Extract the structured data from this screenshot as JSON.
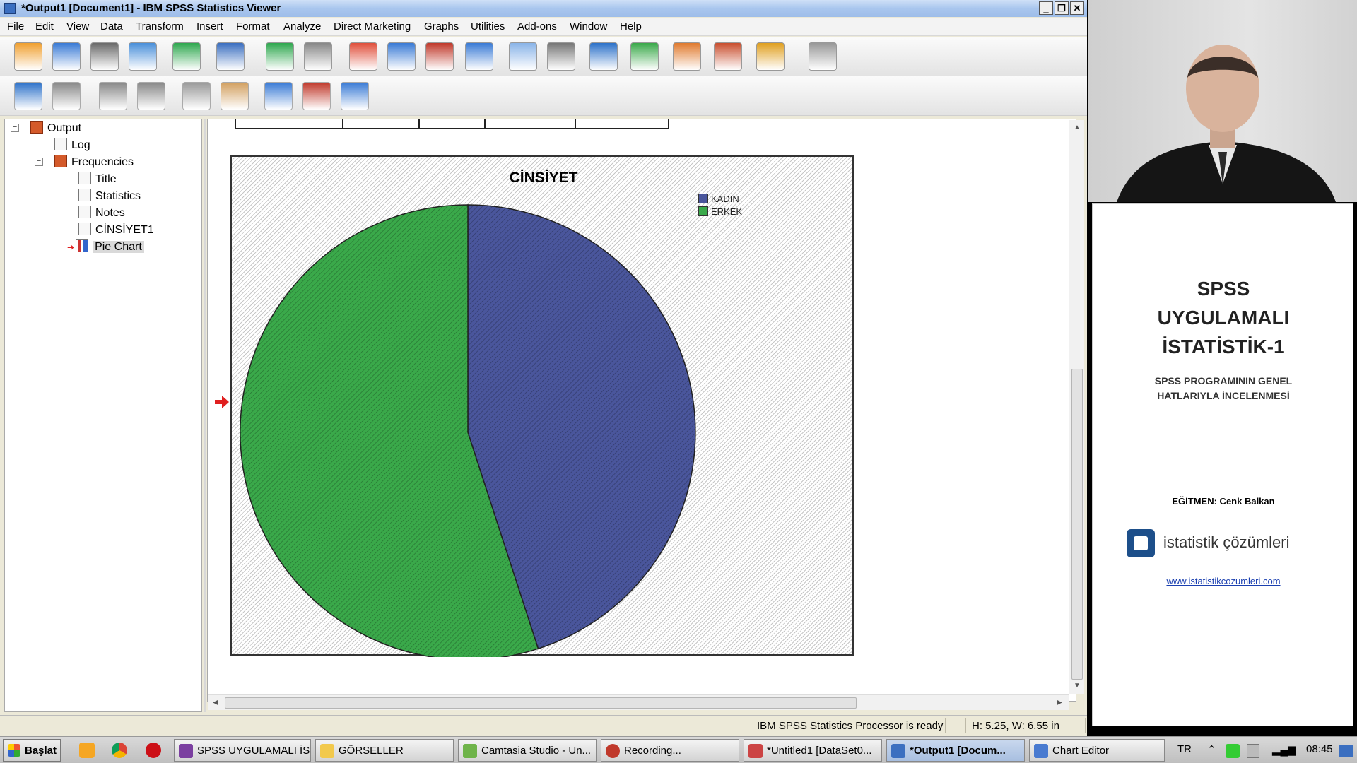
{
  "window": {
    "title": "*Output1 [Document1] - IBM SPSS Statistics Viewer",
    "controls": {
      "minimize": "_",
      "restore": "❐",
      "close": "✕"
    }
  },
  "menu": [
    "File",
    "Edit",
    "View",
    "Data",
    "Transform",
    "Insert",
    "Format",
    "Analyze",
    "Direct Marketing",
    "Graphs",
    "Utilities",
    "Add-ons",
    "Window",
    "Help"
  ],
  "toolbar1_icons": [
    "open-icon",
    "save-icon",
    "print-icon",
    "print-preview-icon",
    "export-icon",
    "recall-dialog-icon",
    "undo-icon",
    "redo-icon",
    "goto-data-icon",
    "goto-case-icon",
    "goto-variable-icon",
    "variables-icon",
    "use-sets-icon",
    "show-all-variables-icon",
    "designate-window-icon",
    "pivot-table-icon",
    "chart-builder-icon",
    "script-icon",
    "run-script-icon",
    "disabled-icon"
  ],
  "toolbar2_icons": [
    "back-icon",
    "forward-icon",
    "expand-icon",
    "collapse-icon",
    "show-icon",
    "hide-icon",
    "insert-heading-icon",
    "insert-title-icon",
    "insert-text-icon"
  ],
  "outline": {
    "root": "Output",
    "log": "Log",
    "frequencies": "Frequencies",
    "items": [
      "Title",
      "Statistics",
      "Notes",
      "CİNSİYET1",
      "Pie Chart"
    ],
    "selected": "Pie Chart",
    "expander_minus": "−"
  },
  "chart_data": {
    "type": "pie",
    "title": "CİNSİYET",
    "labels": [
      "KADIN",
      "ERKEK"
    ],
    "values": [
      45,
      55
    ],
    "colors": [
      "#4a569c",
      "#3aa94a"
    ],
    "start_angle_deg": 0,
    "direction": "clockwise",
    "legend_position": "top-right",
    "pattern": "diagonal-hatch"
  },
  "statusbar": {
    "processor": "IBM SPSS Statistics Processor is ready",
    "size": "H: 5.25, W: 6.55 in"
  },
  "taskbar": {
    "start": "Başlat",
    "tasks": [
      "SPSS UYGULAMALI İS...",
      "GÖRSELLER",
      "Camtasia Studio - Un...",
      "Recording...",
      "*Untitled1 [DataSet0...",
      "*Output1 [Docum...",
      "Chart Editor"
    ],
    "active_task": "*Output1 [Docum...",
    "language": "TR",
    "clock": "08:45"
  },
  "slide": {
    "title_lines": [
      "SPSS",
      "UYGULAMALI",
      "İSTATİSTİK-1"
    ],
    "subtitle_lines": [
      "SPSS PROGRAMININ GENEL",
      "HATLARIYLA İNCELENMESİ"
    ],
    "instructor": "EĞİTMEN: Cenk Balkan",
    "logo_text": "istatistik çözümleri",
    "url": "www.istatistikcozumleri.com"
  }
}
